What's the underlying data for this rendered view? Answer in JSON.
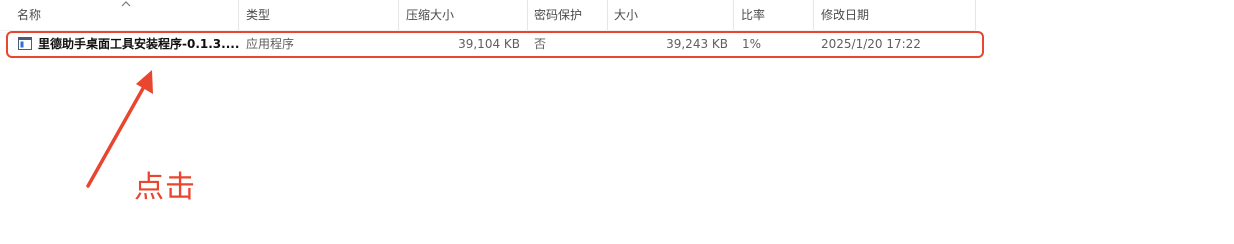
{
  "columns": {
    "name": "名称",
    "type": "类型",
    "compressed_size": "压缩大小",
    "password": "密码保护",
    "size": "大小",
    "ratio": "比率",
    "modified": "修改日期"
  },
  "file": {
    "icon": "exe-file-icon",
    "name": "里德助手桌面工具安装程序-0.1.3....",
    "type": "应用程序",
    "compressed_size": "39,104 KB",
    "password": "否",
    "size": "39,243 KB",
    "ratio": "1%",
    "modified": "2025/1/20 17:22"
  },
  "annotation": {
    "text": "点击",
    "color": "#e8462e"
  }
}
